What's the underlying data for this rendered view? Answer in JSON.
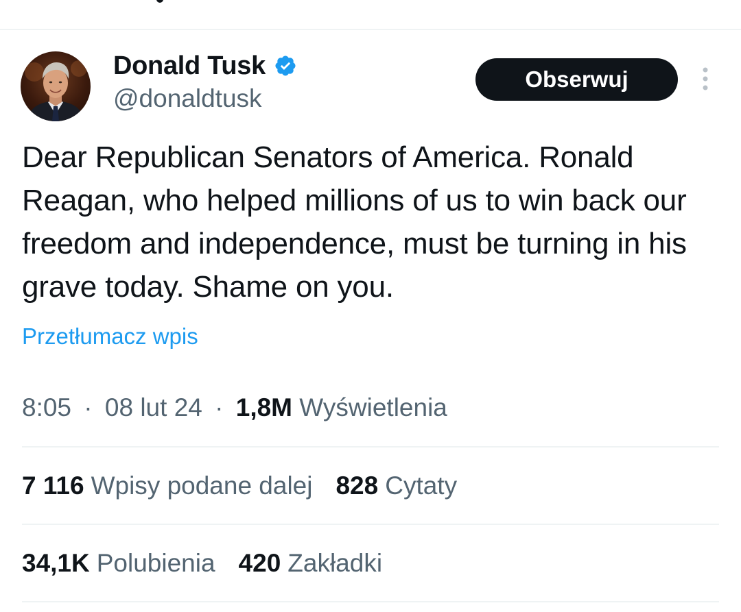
{
  "author": {
    "display_name": "Donald Tusk",
    "handle": "@donaldtusk",
    "verified": true,
    "avatar": "profile-photo"
  },
  "follow_button": {
    "label": "Obserwuj"
  },
  "tweet": {
    "text": "Dear Republican Senators of America. Ronald Reagan, who helped millions of us to win back our freedom and independence, must be turning in his grave today. Shame on you.",
    "translate_label": "Przetłumacz wpis",
    "time": "8:05",
    "date": "08 lut 24",
    "views_count": "1,8M",
    "views_label": "Wyświetlenia",
    "separator": "·"
  },
  "stats": {
    "reposts_count": "7 116",
    "reposts_label": "Wpisy podane dalej",
    "quotes_count": "828",
    "quotes_label": "Cytaty",
    "likes_count": "34,1K",
    "likes_label": "Polubienia",
    "bookmarks_count": "420",
    "bookmarks_label": "Zakładki"
  },
  "icons": {
    "verified": "verified-badge-icon",
    "more": "more-options-icon"
  },
  "colors": {
    "text_primary": "#0f1419",
    "text_secondary": "#536471",
    "link": "#1d9bf0",
    "verified": "#1d9bf0",
    "button_bg": "#0f1419",
    "button_text": "#ffffff",
    "divider": "#eff3f4"
  }
}
